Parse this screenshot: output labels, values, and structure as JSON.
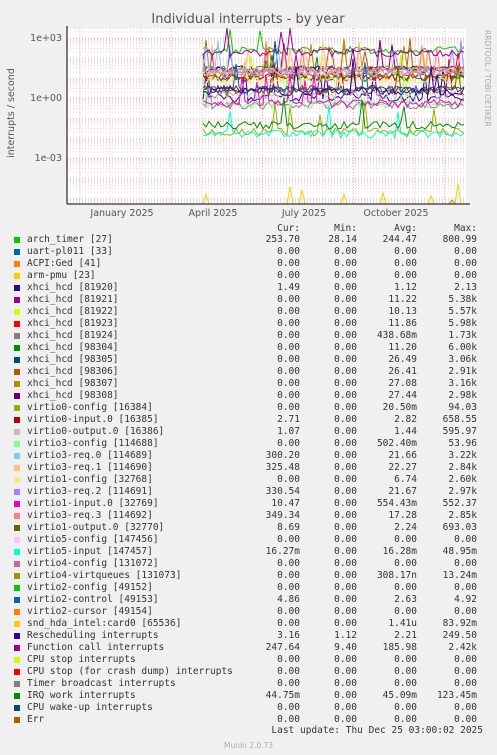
{
  "title": "Individual interrupts - by year",
  "ylabel": "interrupts / second",
  "watermark": "RRDTOOL / TOBI OETIKER",
  "yticks": [
    "1e+03",
    "1e+00",
    "1e-03"
  ],
  "xticks": [
    "January 2025",
    "April 2025",
    "July 2025",
    "October 2025"
  ],
  "headers": {
    "cur": "Cur:",
    "min": "Min:",
    "avg": "Avg:",
    "max": "Max:"
  },
  "last_update": "Last update: Thu Dec 25 03:00:02 2025",
  "footer": "Munin 2.0.73",
  "chart_data": {
    "type": "line",
    "title": "Individual interrupts - by year",
    "ylabel": "interrupts / second",
    "yscale": "log",
    "ylim": [
      1e-06,
      10000
    ],
    "grid": true,
    "x": [
      "January 2025",
      "April 2025",
      "July 2025",
      "October 2025"
    ],
    "legend_placement": "bottom",
    "series": [
      {
        "name": "arch_timer [27]",
        "color": "#00cc00",
        "cur": "253.70",
        "min": "28.14",
        "avg": "244.47",
        "max": "800.99"
      },
      {
        "name": "uart-pl011 [33]",
        "color": "#0066b3",
        "cur": "0.00",
        "min": "0.00",
        "avg": "0.00",
        "max": "0.00"
      },
      {
        "name": "ACPI:Ged [41]",
        "color": "#ff8000",
        "cur": "0.00",
        "min": "0.00",
        "avg": "0.00",
        "max": "0.00"
      },
      {
        "name": "arm-pmu [23]",
        "color": "#ffcc00",
        "cur": "0.00",
        "min": "0.00",
        "avg": "0.00",
        "max": "0.00"
      },
      {
        "name": "xhci_hcd [81920]",
        "color": "#330099",
        "cur": "1.49",
        "min": "0.00",
        "avg": "1.12",
        "max": "2.13"
      },
      {
        "name": "xhci_hcd [81921]",
        "color": "#990099",
        "cur": "0.00",
        "min": "0.00",
        "avg": "11.22",
        "max": "5.38k"
      },
      {
        "name": "xhci_hcd [81922]",
        "color": "#ccff00",
        "cur": "0.00",
        "min": "0.00",
        "avg": "10.13",
        "max": "5.57k"
      },
      {
        "name": "xhci_hcd [81923]",
        "color": "#ff0000",
        "cur": "0.00",
        "min": "0.00",
        "avg": "11.86",
        "max": "5.98k"
      },
      {
        "name": "xhci_hcd [81924]",
        "color": "#808080",
        "cur": "0.00",
        "min": "0.00",
        "avg": "438.68m",
        "max": "1.73k"
      },
      {
        "name": "xhci_hcd [98304]",
        "color": "#008f00",
        "cur": "0.00",
        "min": "0.00",
        "avg": "11.20",
        "max": "6.00k"
      },
      {
        "name": "xhci_hcd [98305]",
        "color": "#00487d",
        "cur": "0.00",
        "min": "0.00",
        "avg": "26.49",
        "max": "3.06k"
      },
      {
        "name": "xhci_hcd [98306]",
        "color": "#b35a00",
        "cur": "0.00",
        "min": "0.00",
        "avg": "26.41",
        "max": "2.91k"
      },
      {
        "name": "xhci_hcd [98307]",
        "color": "#b38f00",
        "cur": "0.00",
        "min": "0.00",
        "avg": "27.08",
        "max": "3.16k"
      },
      {
        "name": "xhci_hcd [98308]",
        "color": "#6b006b",
        "cur": "0.00",
        "min": "0.00",
        "avg": "27.44",
        "max": "2.98k"
      },
      {
        "name": "virtio0-config [16384]",
        "color": "#8fb300",
        "cur": "0.00",
        "min": "0.00",
        "avg": "20.50m",
        "max": "94.03"
      },
      {
        "name": "virtio0-input.0 [16385]",
        "color": "#b30000",
        "cur": "2.71",
        "min": "0.00",
        "avg": "2.82",
        "max": "658.55"
      },
      {
        "name": "virtio0-output.0 [16386]",
        "color": "#bebebe",
        "cur": "1.07",
        "min": "0.00",
        "avg": "1.44",
        "max": "595.97"
      },
      {
        "name": "virtio3-config [114688]",
        "color": "#80ff80",
        "cur": "0.00",
        "min": "0.00",
        "avg": "502.40m",
        "max": "53.96"
      },
      {
        "name": "virtio3-req.0 [114689]",
        "color": "#80c9ff",
        "cur": "300.20",
        "min": "0.00",
        "avg": "21.66",
        "max": "3.22k"
      },
      {
        "name": "virtio3-req.1 [114690]",
        "color": "#ffc080",
        "cur": "325.48",
        "min": "0.00",
        "avg": "22.27",
        "max": "2.84k"
      },
      {
        "name": "virtio1-config [32768]",
        "color": "#ffe680",
        "cur": "0.00",
        "min": "0.00",
        "avg": "6.74",
        "max": "2.60k"
      },
      {
        "name": "virtio3-req.2 [114691]",
        "color": "#aa80ff",
        "cur": "330.54",
        "min": "0.00",
        "avg": "21.67",
        "max": "2.97k"
      },
      {
        "name": "virtio1-input.0 [32769]",
        "color": "#ee00cc",
        "cur": "10.47",
        "min": "0.00",
        "avg": "554.43m",
        "max": "552.37"
      },
      {
        "name": "virtio3-req.3 [114692]",
        "color": "#ff8080",
        "cur": "349.34",
        "min": "0.00",
        "avg": "17.28",
        "max": "2.85k"
      },
      {
        "name": "virtio1-output.0 [32770]",
        "color": "#666600",
        "cur": "8.69",
        "min": "0.00",
        "avg": "2.24",
        "max": "693.03"
      },
      {
        "name": "virtio5-config [147456]",
        "color": "#ffbfff",
        "cur": "0.00",
        "min": "0.00",
        "avg": "0.00",
        "max": "0.00"
      },
      {
        "name": "virtio5-input [147457]",
        "color": "#00ffcc",
        "cur": "16.27m",
        "min": "0.00",
        "avg": "16.28m",
        "max": "48.95m"
      },
      {
        "name": "virtio4-config [131072]",
        "color": "#cc6699",
        "cur": "0.00",
        "min": "0.00",
        "avg": "0.00",
        "max": "0.00"
      },
      {
        "name": "virtio4-virtqueues [131073]",
        "color": "#999900",
        "cur": "0.00",
        "min": "0.00",
        "avg": "308.17n",
        "max": "13.24m"
      },
      {
        "name": "virtio2-config [49152]",
        "color": "#00cc00",
        "cur": "0.00",
        "min": "0.00",
        "avg": "0.00",
        "max": "0.00"
      },
      {
        "name": "virtio2-control [49153]",
        "color": "#0066b3",
        "cur": "4.86",
        "min": "0.00",
        "avg": "2.63",
        "max": "4.92"
      },
      {
        "name": "virtio2-cursor [49154]",
        "color": "#ff8000",
        "cur": "0.00",
        "min": "0.00",
        "avg": "0.00",
        "max": "0.00"
      },
      {
        "name": "snd_hda_intel:card0 [65536]",
        "color": "#ffcc00",
        "cur": "0.00",
        "min": "0.00",
        "avg": "1.41u",
        "max": "83.92m"
      },
      {
        "name": "Rescheduling interrupts",
        "color": "#330099",
        "cur": "3.16",
        "min": "1.12",
        "avg": "2.21",
        "max": "249.50"
      },
      {
        "name": "Function call interrupts",
        "color": "#990099",
        "cur": "247.64",
        "min": "9.40",
        "avg": "185.98",
        "max": "2.42k"
      },
      {
        "name": "CPU stop interrupts",
        "color": "#ccff00",
        "cur": "0.00",
        "min": "0.00",
        "avg": "0.00",
        "max": "0.00"
      },
      {
        "name": "CPU stop (for crash dump) interrupts",
        "color": "#ff0000",
        "cur": "0.00",
        "min": "0.00",
        "avg": "0.00",
        "max": "0.00"
      },
      {
        "name": "Timer broadcast interrupts",
        "color": "#808080",
        "cur": "0.00",
        "min": "0.00",
        "avg": "0.00",
        "max": "0.00"
      },
      {
        "name": "IRQ work interrupts",
        "color": "#008f00",
        "cur": "44.75m",
        "min": "0.00",
        "avg": "45.09m",
        "max": "123.45m"
      },
      {
        "name": "CPU wake-up interrupts",
        "color": "#00487d",
        "cur": "0.00",
        "min": "0.00",
        "avg": "0.00",
        "max": "0.00"
      },
      {
        "name": "Err",
        "color": "#b35a00",
        "cur": "0.00",
        "min": "0.00",
        "avg": "0.00",
        "max": "0.00"
      }
    ]
  }
}
